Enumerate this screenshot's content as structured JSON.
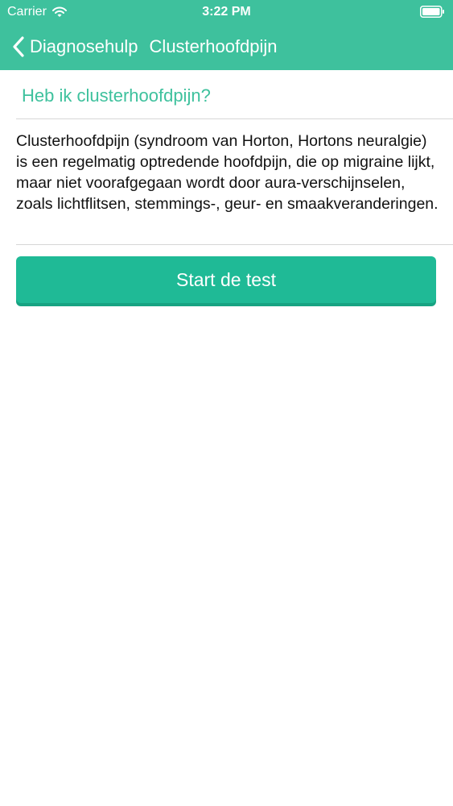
{
  "status_bar": {
    "carrier": "Carrier",
    "time": "3:22 PM",
    "icons": [
      "wifi-icon",
      "battery-icon"
    ]
  },
  "nav": {
    "back_label": "Diagnosehulp",
    "back_icon": "chevron-left-icon",
    "title": "Clusterhoofdpijn"
  },
  "content": {
    "question": "Heb ik clusterhoofdpijn?",
    "description": "Clusterhoofdpijn (syndroom van Horton, Hortons neuralgie) is een regelmatig optredende hoofdpijn, die op migraine lijkt, maar niet voorafgegaan wordt door aura-verschijnselen, zoals lichtflitsen, stemmings-, geur- en smaakveranderingen.",
    "start_button": "Start de test"
  },
  "colors": {
    "accent": "#3ec19d",
    "button": "#1fba96",
    "button_shadow": "#17a382",
    "divider": "#d6d6d6",
    "text": "#111111",
    "background": "#ffffff"
  }
}
